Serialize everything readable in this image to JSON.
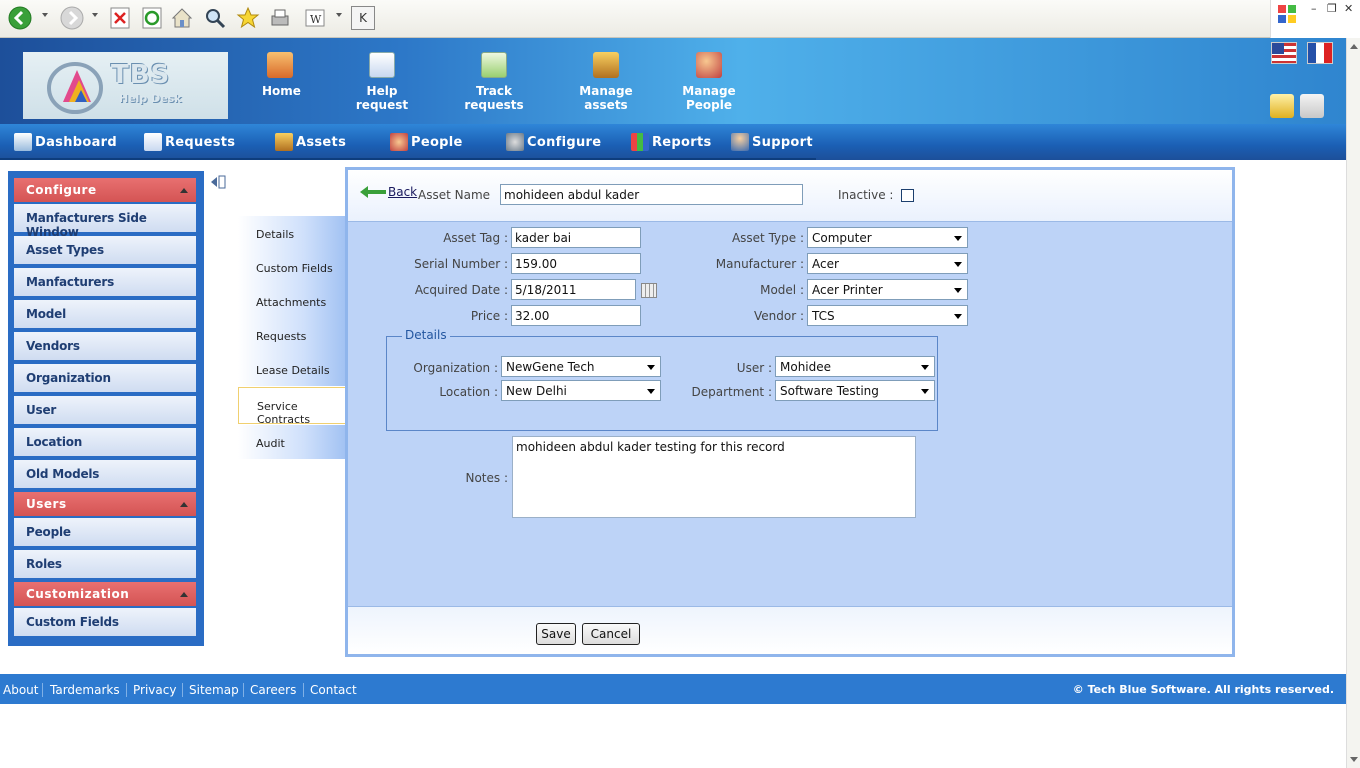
{
  "browser": {
    "tk_label": "K",
    "win_min": "–",
    "win_restore": "❐",
    "win_close": "✕"
  },
  "header": {
    "logo_text": "TBS",
    "logo_sub": "Help Desk",
    "nav": [
      {
        "label": "Home"
      },
      {
        "label": "Help request"
      },
      {
        "label": "Track requests"
      },
      {
        "label": "Manage assets"
      },
      {
        "label": "Manage People"
      }
    ]
  },
  "menu": [
    {
      "label": "Dashboard"
    },
    {
      "label": "Requests"
    },
    {
      "label": "Assets"
    },
    {
      "label": "People"
    },
    {
      "label": "Configure"
    },
    {
      "label": "Reports"
    },
    {
      "label": "Support"
    }
  ],
  "sidebar": {
    "configure_title": "Configure",
    "configure_items": [
      "Manfacturers Side Window",
      "Asset Types",
      "Manfacturers",
      "Model",
      "Vendors",
      "Organization",
      "User",
      "Location",
      "Old Models"
    ],
    "users_title": "Users",
    "users_items": [
      "People",
      "Roles"
    ],
    "custom_title": "Customization",
    "custom_items": [
      "Custom Fields"
    ]
  },
  "tabs": [
    "Details",
    "Custom Fields",
    "Attachments",
    "Requests",
    "Lease Details",
    "Service Contracts",
    "Audit"
  ],
  "form": {
    "back_label": "Back",
    "asset_name_label": "Asset Name",
    "asset_name_value": "mohideen abdul kader",
    "inactive_label": "Inactive :",
    "asset_tag_label": "Asset Tag :",
    "asset_tag_value": "kader bai",
    "serial_label": "Serial Number :",
    "serial_value": "159.00",
    "acquired_label": "Acquired Date :",
    "acquired_value": "5/18/2011",
    "price_label": "Price :",
    "price_value": "32.00",
    "asset_type_label": "Asset Type :",
    "asset_type_value": "Computer",
    "manufacturer_label": "Manufacturer :",
    "manufacturer_value": "Acer",
    "model_label": "Model :",
    "model_value": "Acer Printer",
    "vendor_label": "Vendor :",
    "vendor_value": "TCS",
    "details_legend": "Details",
    "organization_label": "Organization :",
    "organization_value": "NewGene Tech",
    "location_label": "Location :",
    "location_value": "New Delhi",
    "user_label": "User :",
    "user_value": "Mohidee",
    "department_label": "Department :",
    "department_value": "Software Testing",
    "notes_label": "Notes :",
    "notes_value": "mohideen abdul kader testing for this record",
    "save_label": "Save",
    "cancel_label": "Cancel"
  },
  "footer": {
    "links": [
      "About",
      "Tardemarks",
      "Privacy",
      "Sitemap",
      "Careers",
      "Contact"
    ],
    "copyright": "© Tech Blue Software. All rights reserved."
  }
}
